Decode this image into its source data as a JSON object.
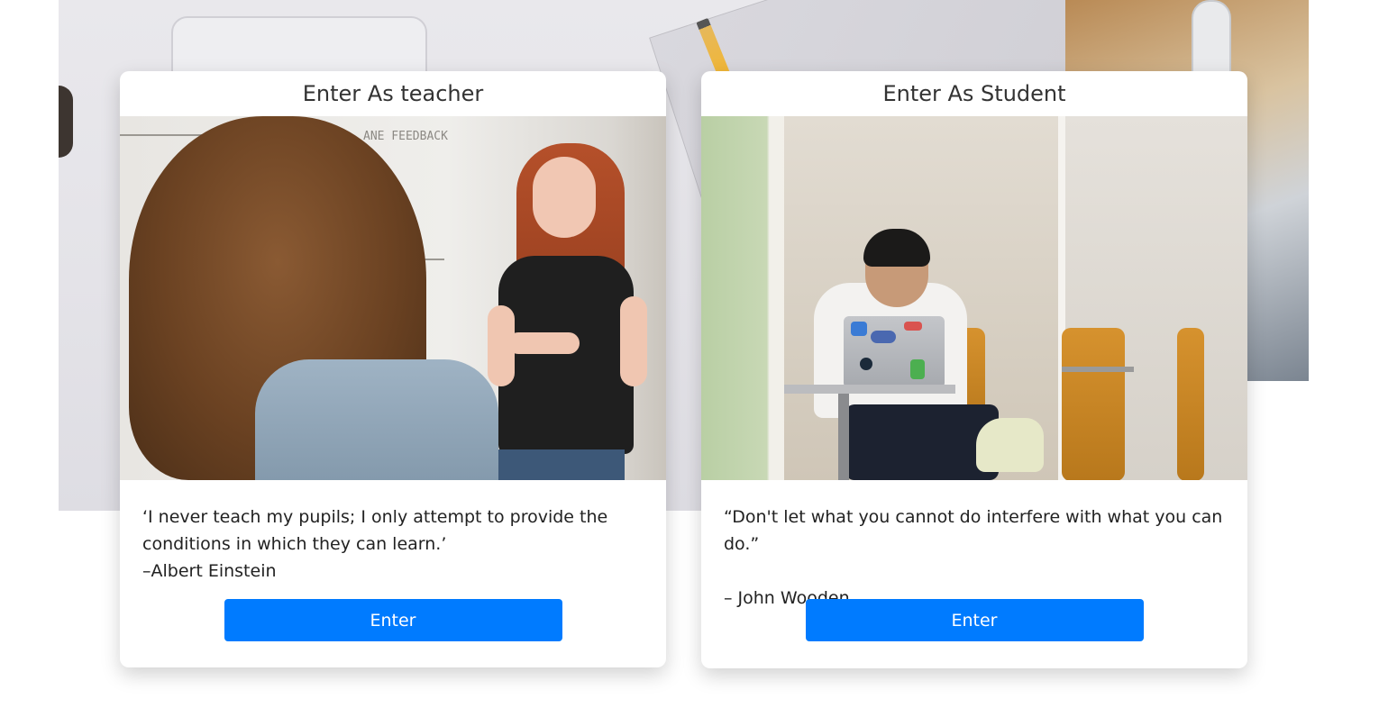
{
  "teacher_card": {
    "title": "Enter As teacher",
    "quote_lines": [
      "‘I never teach my pupils; I only attempt to provide the",
      "conditions in which they can learn.’",
      "–Albert Einstein"
    ],
    "button_label": "Enter"
  },
  "student_card": {
    "title": "Enter As Student",
    "quote_line": "“Don't let what you cannot do interfere with what you can do.”",
    "author": "– John Wooden.",
    "button_label": "Enter"
  },
  "colors": {
    "primary": "#007bff",
    "card_background": "#ffffff",
    "text": "#222222"
  },
  "icons": {
    "teacher_image": "teacher-at-whiteboard-photo",
    "student_image": "student-with-laptop-photo",
    "background_image": "desk-workspace-photo"
  }
}
